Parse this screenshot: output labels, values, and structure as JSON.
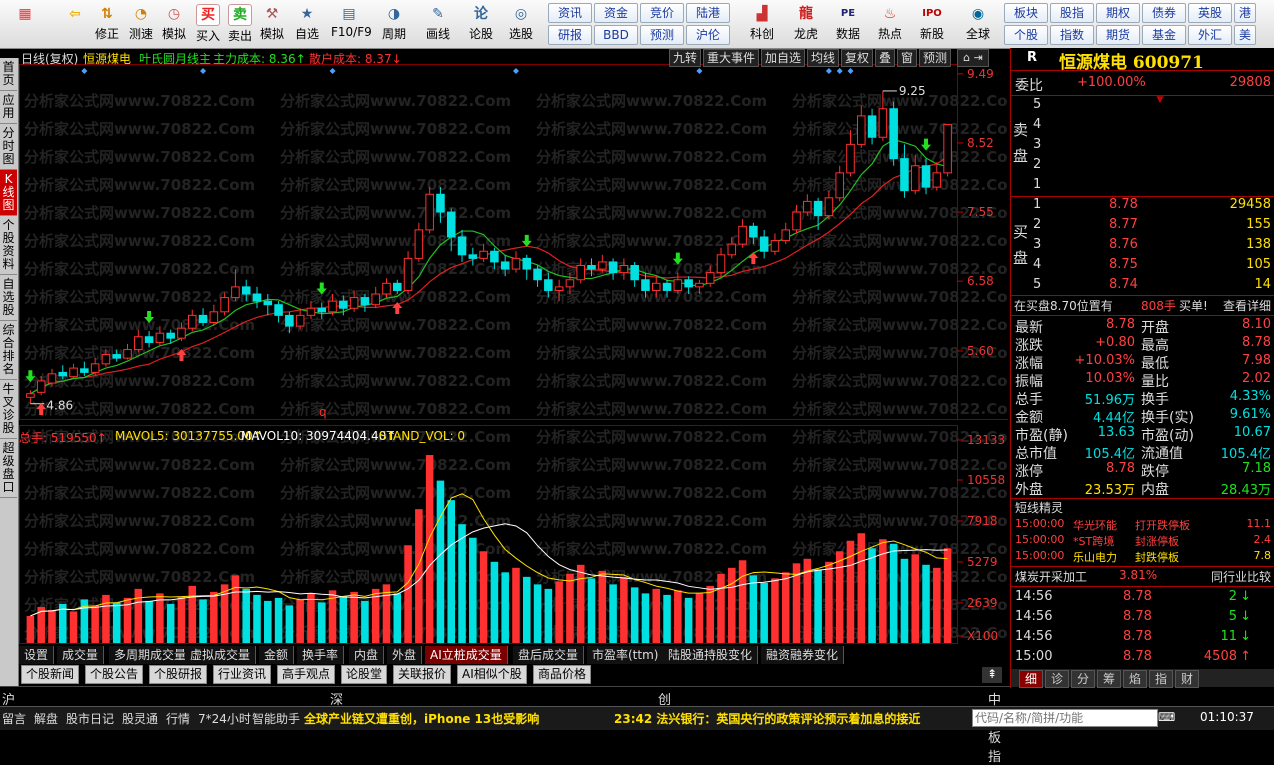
{
  "toolbar": {
    "buttons": [
      {
        "label": "",
        "icon": "grid-icon"
      },
      {
        "label": "",
        "icon": "back-arrow-icon"
      },
      {
        "label": "修正",
        "icon": "up-down-icon"
      },
      {
        "label": "测速",
        "icon": "speed-icon"
      },
      {
        "label": "模拟",
        "icon": "clock-icon"
      },
      {
        "label": "买入",
        "icon": "buy-icon"
      },
      {
        "label": "卖出",
        "icon": "sell-icon"
      },
      {
        "label": "模拟",
        "icon": "hammer-icon"
      },
      {
        "label": "自选",
        "icon": "favorite-icon"
      },
      {
        "label": "F10/F9",
        "icon": "f10-icon"
      },
      {
        "label": "周期",
        "icon": "cycle-icon"
      },
      {
        "label": "画线",
        "icon": "pencil-icon"
      },
      {
        "label": "论股",
        "icon": "forum-icon"
      },
      {
        "label": "选股",
        "icon": "stock-picker-icon"
      }
    ],
    "small_buttons": [
      [
        "资讯",
        "资金",
        "竞价",
        "陆港"
      ],
      [
        "研报",
        "BBD",
        "预测",
        "沪伦"
      ]
    ],
    "icon_buttons": [
      {
        "label": "科创",
        "icon": "star-market-icon"
      },
      {
        "label": "龙虎",
        "icon": "dragon-tiger-icon"
      },
      {
        "label": "数据",
        "icon": "data-icon"
      },
      {
        "label": "热点",
        "icon": "hot-icon"
      },
      {
        "label": "新股",
        "icon": "ipo-icon"
      },
      {
        "label": "全球",
        "icon": "globe-icon"
      }
    ],
    "right_buttons": [
      [
        "板块",
        "股指",
        "期权",
        "债券",
        "英股",
        "港"
      ],
      [
        "个股",
        "指数",
        "期货",
        "基金",
        "外汇",
        "美"
      ]
    ]
  },
  "leftnav": [
    "首页",
    "应用",
    "分时图",
    "K线图",
    "个股资料",
    "自选股",
    "综合排名",
    "牛叉诊股",
    "超级盘口"
  ],
  "chart": {
    "header_left": "日线(复权)",
    "stock_name": "恒源煤电",
    "main_line": "叶氏圆月线主",
    "main_cost": "主力成本: 8.36↑",
    "retail_cost": "散户成本: 8.37↓",
    "buttons": [
      "九转",
      "重大事件",
      "加自选",
      "均线",
      "复权",
      "叠",
      "窗",
      "预测"
    ],
    "price_axis": [
      "9.49",
      "8.52",
      "7.55",
      "6.58",
      "5.60"
    ],
    "vol_axis": [
      "13133",
      "10558",
      "7918",
      "5279",
      "2639",
      "X100"
    ],
    "high_label": "9.25",
    "low_label": "4.86",
    "q_label": "q",
    "watermark": "分析家公式网www.70822.Com",
    "vol_header": {
      "total": "总手: 519550↑",
      "mavol5": "MAVOL5: 30137755.00↑",
      "mavol10": "MAVOL10: 30974404.40↑",
      "stand": "STAND_VOL: 0"
    },
    "colors": {
      "up": "#ff3030",
      "down": "#00e0e0",
      "ma_green": "#20c020",
      "ma_red": "#e02020"
    }
  },
  "chart_data": {
    "type": "candlestick",
    "candles": [
      [
        4.95,
        5.0,
        4.86,
        5.05
      ],
      [
        5.02,
        5.18,
        4.98,
        5.25
      ],
      [
        5.15,
        5.28,
        5.1,
        5.35
      ],
      [
        5.3,
        5.25,
        5.2,
        5.4
      ],
      [
        5.24,
        5.36,
        5.2,
        5.42
      ],
      [
        5.35,
        5.3,
        5.25,
        5.45
      ],
      [
        5.3,
        5.42,
        5.26,
        5.5
      ],
      [
        5.42,
        5.55,
        5.38,
        5.62
      ],
      [
        5.55,
        5.5,
        5.45,
        5.62
      ],
      [
        5.5,
        5.62,
        5.48,
        5.7
      ],
      [
        5.62,
        5.8,
        5.58,
        5.9
      ],
      [
        5.8,
        5.72,
        5.65,
        5.88
      ],
      [
        5.72,
        5.85,
        5.68,
        5.95
      ],
      [
        5.85,
        5.78,
        5.7,
        5.9
      ],
      [
        5.78,
        5.92,
        5.74,
        6.0
      ],
      [
        5.92,
        6.1,
        5.88,
        6.18
      ],
      [
        6.1,
        6.0,
        5.95,
        6.2
      ],
      [
        6.0,
        6.15,
        5.95,
        6.25
      ],
      [
        6.15,
        6.35,
        6.1,
        6.42
      ],
      [
        6.35,
        6.5,
        6.3,
        6.75
      ],
      [
        6.5,
        6.4,
        6.3,
        6.6
      ],
      [
        6.4,
        6.3,
        6.2,
        6.5
      ],
      [
        6.3,
        6.25,
        6.1,
        6.4
      ],
      [
        6.25,
        6.1,
        6.0,
        6.3
      ],
      [
        6.1,
        5.95,
        5.85,
        6.15
      ],
      [
        5.95,
        6.1,
        5.9,
        6.2
      ],
      [
        6.1,
        6.2,
        6.05,
        6.3
      ],
      [
        6.2,
        6.15,
        6.05,
        6.28
      ],
      [
        6.15,
        6.3,
        6.1,
        6.4
      ],
      [
        6.3,
        6.2,
        6.1,
        6.38
      ],
      [
        6.2,
        6.35,
        6.15,
        6.45
      ],
      [
        6.35,
        6.25,
        6.15,
        6.4
      ],
      [
        6.25,
        6.4,
        6.2,
        6.5
      ],
      [
        6.4,
        6.55,
        6.35,
        6.62
      ],
      [
        6.55,
        6.45,
        6.4,
        6.6
      ],
      [
        6.45,
        6.9,
        6.4,
        7.0
      ],
      [
        6.9,
        7.3,
        6.85,
        7.4
      ],
      [
        7.3,
        7.8,
        7.25,
        7.9
      ],
      [
        7.8,
        7.55,
        7.4,
        7.9
      ],
      [
        7.55,
        7.2,
        7.0,
        7.6
      ],
      [
        7.2,
        6.95,
        6.85,
        7.3
      ],
      [
        6.95,
        6.9,
        6.8,
        7.05
      ],
      [
        6.9,
        7.0,
        6.85,
        7.1
      ],
      [
        7.0,
        6.85,
        6.75,
        7.05
      ],
      [
        6.85,
        6.75,
        6.65,
        6.95
      ],
      [
        6.75,
        6.9,
        6.7,
        7.0
      ],
      [
        6.9,
        6.75,
        6.6,
        6.95
      ],
      [
        6.75,
        6.6,
        6.5,
        6.8
      ],
      [
        6.6,
        6.45,
        6.35,
        6.7
      ],
      [
        6.45,
        6.5,
        6.3,
        6.6
      ],
      [
        6.5,
        6.6,
        6.4,
        6.7
      ],
      [
        6.6,
        6.8,
        6.55,
        6.9
      ],
      [
        6.8,
        6.75,
        6.65,
        6.9
      ],
      [
        6.75,
        6.85,
        6.7,
        6.95
      ],
      [
        6.85,
        6.7,
        6.6,
        6.9
      ],
      [
        6.7,
        6.8,
        6.6,
        6.9
      ],
      [
        6.8,
        6.6,
        6.5,
        6.85
      ],
      [
        6.6,
        6.45,
        6.35,
        6.7
      ],
      [
        6.45,
        6.55,
        6.35,
        6.65
      ],
      [
        6.55,
        6.45,
        6.35,
        6.6
      ],
      [
        6.45,
        6.6,
        6.4,
        6.7
      ],
      [
        6.6,
        6.5,
        6.4,
        6.65
      ],
      [
        6.5,
        6.55,
        6.4,
        6.6
      ],
      [
        6.55,
        6.7,
        6.5,
        6.8
      ],
      [
        6.7,
        6.95,
        6.65,
        7.05
      ],
      [
        6.95,
        7.1,
        6.9,
        7.2
      ],
      [
        7.1,
        7.35,
        7.05,
        7.45
      ],
      [
        7.35,
        7.2,
        7.1,
        7.4
      ],
      [
        7.2,
        7.0,
        6.9,
        7.3
      ],
      [
        7.0,
        7.15,
        6.95,
        7.25
      ],
      [
        7.15,
        7.3,
        7.1,
        7.4
      ],
      [
        7.3,
        7.55,
        7.25,
        7.65
      ],
      [
        7.55,
        7.7,
        7.5,
        7.8
      ],
      [
        7.7,
        7.5,
        7.3,
        7.75
      ],
      [
        7.5,
        7.75,
        7.45,
        7.85
      ],
      [
        7.75,
        8.1,
        7.7,
        8.2
      ],
      [
        8.1,
        8.5,
        8.05,
        8.7
      ],
      [
        8.5,
        8.9,
        8.45,
        9.05
      ],
      [
        8.9,
        8.6,
        8.5,
        9.0
      ],
      [
        8.6,
        9.0,
        8.55,
        9.25
      ],
      [
        9.0,
        8.3,
        8.2,
        9.1
      ],
      [
        8.3,
        7.85,
        7.75,
        8.5
      ],
      [
        7.85,
        8.2,
        7.8,
        8.35
      ],
      [
        8.2,
        7.9,
        7.8,
        8.3
      ],
      [
        7.9,
        8.1,
        7.85,
        8.25
      ],
      [
        8.1,
        8.78,
        8.05,
        8.78
      ]
    ],
    "volumes": [
      1800,
      2400,
      2200,
      2600,
      2100,
      2900,
      2500,
      3200,
      2700,
      3000,
      3600,
      2800,
      3300,
      2600,
      3100,
      3800,
      2900,
      3400,
      3900,
      4500,
      3600,
      3200,
      2800,
      3000,
      2500,
      2900,
      3300,
      2700,
      3500,
      3100,
      3400,
      2800,
      3600,
      3900,
      3300,
      6500,
      8900,
      12500,
      10800,
      9500,
      7900,
      7000,
      6100,
      5400,
      4700,
      5000,
      4400,
      3900,
      3600,
      4100,
      4600,
      5200,
      4300,
      4800,
      3900,
      4400,
      3700,
      3300,
      3600,
      3200,
      3500,
      3000,
      3300,
      3800,
      4600,
      5000,
      5500,
      4500,
      4000,
      4300,
      4700,
      5300,
      5600,
      4900,
      5400,
      6100,
      6800,
      7300,
      6300,
      6900,
      6600,
      5600,
      5900,
      5200,
      5000,
      6300
    ],
    "ylim": [
      4.8,
      9.6
    ],
    "vol_ylim": [
      0,
      13500
    ]
  },
  "tabs1": [
    "设置",
    "成交量",
    "多周期成交量",
    "虚拟成交量",
    "金额",
    "换手率",
    "内盘",
    "外盘",
    "AI立桩成交量",
    "盘后成交量",
    "市盈率(ttm)",
    "陆股通持股变化",
    "融资融券变化"
  ],
  "tabs2": [
    "个股新闻",
    "个股公告",
    "个股研报",
    "行业资讯",
    "高手观点",
    "论股堂",
    "关联报价",
    "AI相似个股",
    "商品价格"
  ],
  "market_strip": [
    "沪",
    "深",
    "创",
    "中小板指"
  ],
  "status": {
    "items": [
      "留言",
      "解盘",
      "股市日记",
      "股灵通",
      "行情",
      "7*24小时",
      "智能助手"
    ],
    "ticker1": "全球产业链又遭重创，iPhone 13也受影响",
    "ticker2": "23:42 法兴银行：英国央行的政策评论预示着加息的接近",
    "search_placeholder": "代码/名称/简拼/功能",
    "time": "01:10:37"
  },
  "rp": {
    "r_badge": "R",
    "title": "恒源煤电 600971",
    "weibi_label": "委比",
    "weibi_value": "+100.00%",
    "weibi_right": "29808",
    "sell_label": "卖盘",
    "buy_label": "买盘",
    "sell_rows": [
      [
        "5",
        "",
        ""
      ],
      [
        "4",
        "",
        ""
      ],
      [
        "3",
        "",
        ""
      ],
      [
        "2",
        "",
        ""
      ],
      [
        "1",
        "",
        ""
      ]
    ],
    "buy_rows": [
      [
        "1",
        "8.78",
        "29458"
      ],
      [
        "2",
        "8.77",
        "155"
      ],
      [
        "3",
        "8.76",
        "138"
      ],
      [
        "4",
        "8.75",
        "105"
      ],
      [
        "5",
        "8.74",
        "14"
      ]
    ],
    "notice": "在买盘8.70位置有",
    "notice_vol": "808手",
    "notice_action": "买单!",
    "notice_link": "查看详细",
    "stats": [
      [
        "最新",
        "8.78",
        "开盘",
        "8.10"
      ],
      [
        "涨跌",
        "+0.80",
        "最高",
        "8.78"
      ],
      [
        "涨幅",
        "+10.03%",
        "最低",
        "7.98"
      ],
      [
        "振幅",
        "10.03%",
        "量比",
        "2.02"
      ],
      [
        "总手",
        "51.96万",
        "换手",
        "4.33%"
      ],
      [
        "金额",
        "4.44亿",
        "换手(实)",
        "9.61%"
      ],
      [
        "市盈(静)",
        "13.63",
        "市盈(动)",
        "10.67"
      ],
      [
        "总市值",
        "105.4亿",
        "流通值",
        "105.4亿"
      ],
      [
        "涨停",
        "8.78",
        "跌停",
        "7.18"
      ],
      [
        "外盘",
        "23.53万",
        "内盘",
        "28.43万"
      ]
    ],
    "spirit_title": "短线精灵",
    "spirit": [
      [
        "15:00:00",
        "华光环能",
        "打开跌停板",
        "11.1"
      ],
      [
        "15:00:00",
        "*ST跨境",
        "封涨停板",
        "2.4"
      ],
      [
        "15:00:00",
        "乐山电力",
        "封跌停板",
        "7.8"
      ]
    ],
    "industry": "煤炭开采加工",
    "industry_chg": "3.81%",
    "industry_link": "同行业比较",
    "ticks": [
      [
        "14:56",
        "8.78",
        "2",
        "down"
      ],
      [
        "14:56",
        "8.78",
        "5",
        "down"
      ],
      [
        "14:56",
        "8.78",
        "11",
        "down"
      ],
      [
        "15:00",
        "8.78",
        "4508",
        "up"
      ]
    ],
    "bottom_tabs": [
      "细",
      "诊",
      "分",
      "筹",
      "焰",
      "指",
      "财"
    ]
  }
}
